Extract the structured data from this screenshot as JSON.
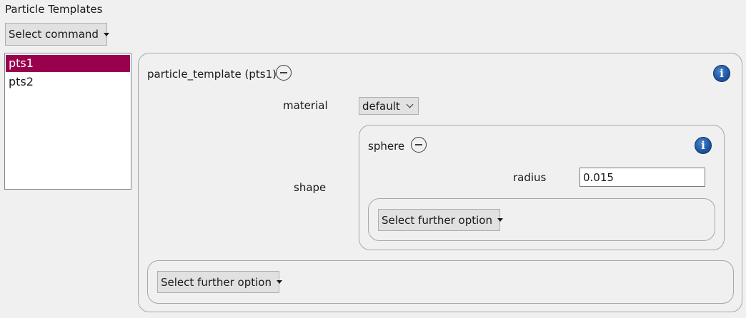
{
  "header": {
    "title": "Particle Templates",
    "command_button": "Select command"
  },
  "templates_list": {
    "items": [
      {
        "label": "pts1",
        "selected": true
      },
      {
        "label": "pts2",
        "selected": false
      }
    ]
  },
  "template_panel": {
    "title": "particle_template (pts1)",
    "material": {
      "label": "material",
      "value": "default"
    },
    "shape": {
      "label": "shape",
      "type_title": "sphere",
      "radius_label": "radius",
      "radius_value": "0.015",
      "further_option_button": "Select further option"
    },
    "further_option_button": "Select further option"
  },
  "colors": {
    "selection": "#99004d",
    "info_icon": "#1f5aa6",
    "background": "#f0f0f0"
  },
  "icons": {
    "collapse": "minus-circle-icon",
    "info": "info-icon",
    "caret": "caret-down-icon"
  }
}
